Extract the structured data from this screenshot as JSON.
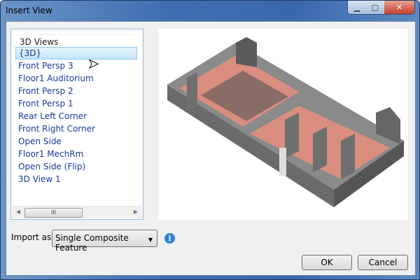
{
  "window": {
    "title": "Insert View",
    "min_icon": "minimize-icon",
    "max_icon": "maximize-icon",
    "close_icon": "close-icon"
  },
  "list": {
    "header": "3D Views",
    "selected_index": 0,
    "items": [
      "{3D}",
      "Front Persp 3",
      "Floor1 Auditorium",
      "Front Persp 2",
      "Front Persp 1",
      "Rear Left Corner",
      "Front Right Corner",
      "Open Side",
      "Floor1 MechRm",
      "Open Side (Flip)",
      "3D View 1"
    ],
    "scroll_thumb": "III"
  },
  "import": {
    "label": "Import as",
    "value": "Single Composite Feature"
  },
  "buttons": {
    "ok": "OK",
    "cancel": "Cancel"
  },
  "colors": {
    "accent": "#2f7fd6",
    "item_text": "#1a3a9a",
    "floor": "#d98e80",
    "wall": "#7a7a7a"
  }
}
